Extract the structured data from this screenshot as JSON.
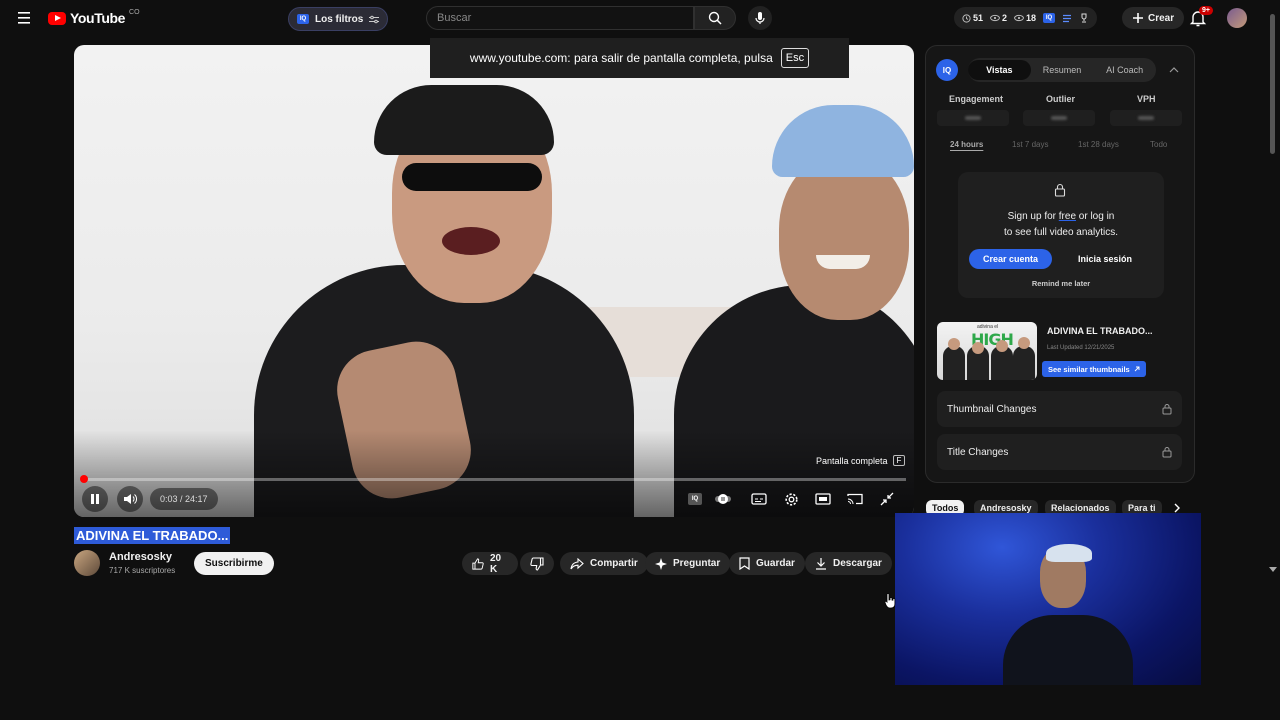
{
  "header": {
    "logo_text": "YouTube",
    "country_code": "CO",
    "filter_label": "Los filtros",
    "search_placeholder": "Buscar",
    "stats": {
      "views_a": "51",
      "views_b": "2",
      "views_c": "18"
    },
    "create_label": "Crear",
    "notification_count": "9+"
  },
  "fullscreen_notice": {
    "text": "www.youtube.com: para salir de pantalla completa, pulsa",
    "key": "Esc"
  },
  "player": {
    "time_current": "0:03",
    "time_total": "24:17",
    "time_display": "0:03 / 24:17",
    "progress_fraction": 0.002,
    "fullscreen_hint": "Pantalla completa",
    "fullscreen_key": "F",
    "playing": true
  },
  "video": {
    "title": "ADIVINA EL TRABADO...",
    "channel_name": "Andresosky",
    "subscribers": "717 K suscriptores",
    "subscribe_label": "Suscribirme",
    "likes": "20 K",
    "share_label": "Compartir",
    "ask_label": "Preguntar",
    "save_label": "Guardar",
    "download_label": "Descargar"
  },
  "analytics_panel": {
    "logo": "IQ",
    "tabs": [
      "Vistas",
      "Resumen",
      "AI Coach"
    ],
    "active_tab": "Vistas",
    "metrics": [
      "Engagement",
      "Outlier",
      "VPH"
    ],
    "ranges": [
      "24 hours",
      "1st 7 days",
      "1st 28 days",
      "Todo"
    ],
    "active_range": "24 hours",
    "lock": {
      "line1_prefix": "Sign up for ",
      "line1_free": "free",
      "line1_suffix": " or log in",
      "line2": "to see full video analytics.",
      "create_account": "Crear cuenta",
      "login": "Inicia sesión",
      "remind": "Remind me later"
    },
    "thumbnail": {
      "title": "ADIVINA EL TRABADO...",
      "last_updated": "Last Updated 12/21/2025",
      "similar_label": "See similar thumbnails",
      "thumb_text": "HIGH",
      "thumb_small": "adivina el"
    },
    "thumbnail_changes": "Thumbnail Changes",
    "title_changes": "Title Changes"
  },
  "chips": [
    "Todos",
    "Andresosky",
    "Relacionados",
    "Para ti"
  ],
  "colors": {
    "accent_blue": "#2c63e8",
    "youtube_red": "#ff0000",
    "background": "#0f0f0f"
  }
}
